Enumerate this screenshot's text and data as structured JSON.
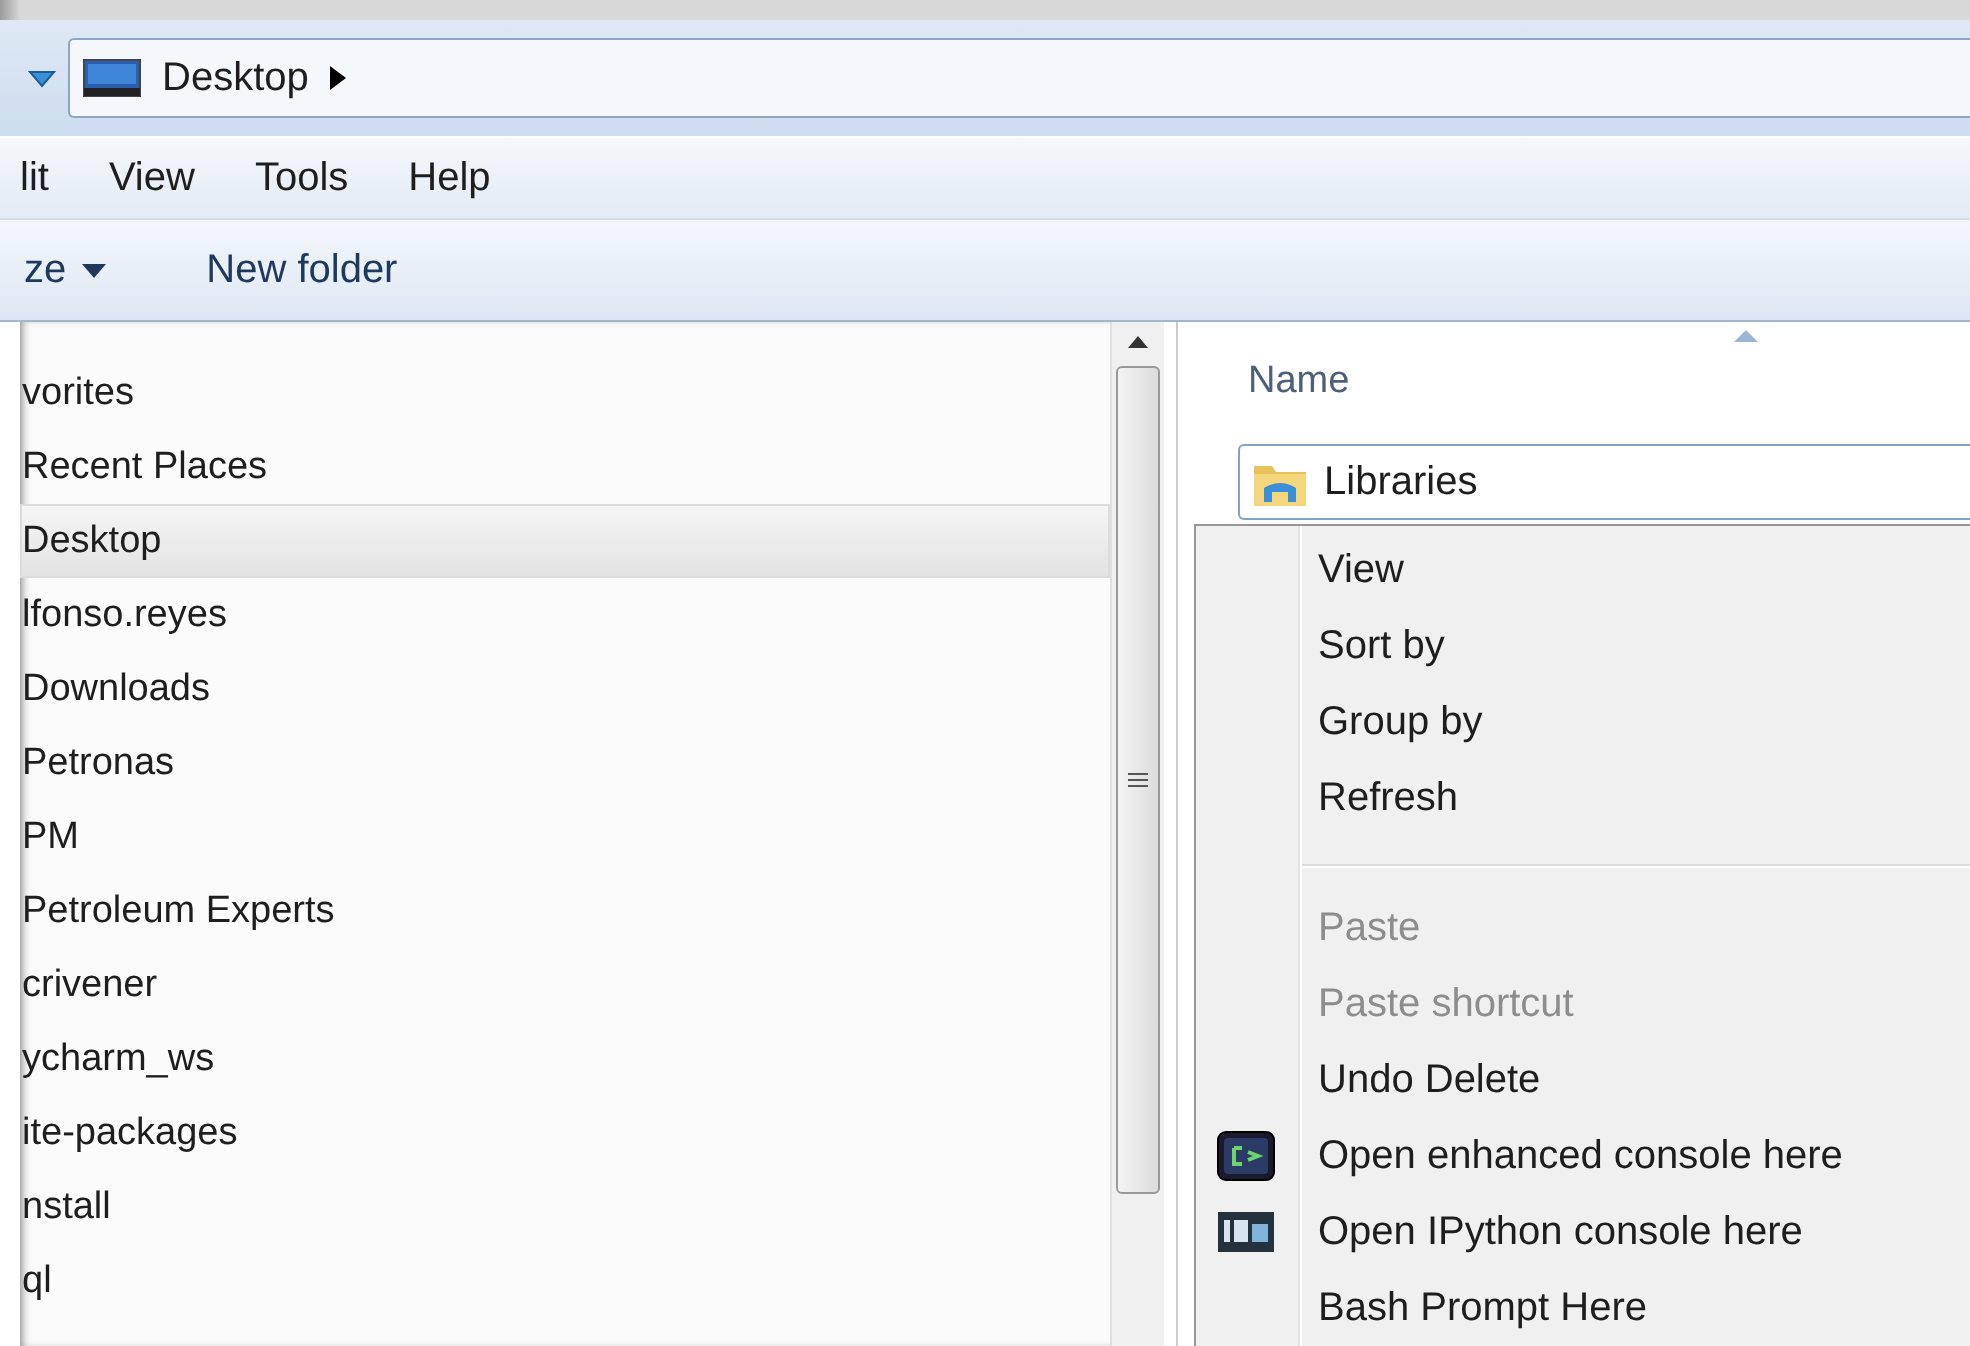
{
  "address_bar": {
    "location": "Desktop"
  },
  "menu_bar": [
    "lit",
    "View",
    "Tools",
    "Help"
  ],
  "toolbar": {
    "organize": "ze",
    "new_folder": "New folder"
  },
  "navigation": {
    "items": [
      {
        "label": "vorites",
        "selected": false
      },
      {
        "label": "Recent Places",
        "selected": false
      },
      {
        "label": "Desktop",
        "selected": true
      },
      {
        "label": "lfonso.reyes",
        "selected": false
      },
      {
        "label": "Downloads",
        "selected": false
      },
      {
        "label": "Petronas",
        "selected": false
      },
      {
        "label": "PM",
        "selected": false
      },
      {
        "label": "Petroleum Experts",
        "selected": false
      },
      {
        "label": "crivener",
        "selected": false
      },
      {
        "label": "ycharm_ws",
        "selected": false
      },
      {
        "label": "ite-packages",
        "selected": false
      },
      {
        "label": "nstall",
        "selected": false
      },
      {
        "label": "ql",
        "selected": false
      }
    ]
  },
  "file_list": {
    "column": "Name",
    "items": [
      {
        "name": "Libraries",
        "selected": true
      }
    ]
  },
  "context_menu": {
    "items": [
      {
        "kind": "command",
        "label": "View",
        "disabled": false
      },
      {
        "kind": "command",
        "label": "Sort by",
        "disabled": false
      },
      {
        "kind": "command",
        "label": "Group by",
        "disabled": false
      },
      {
        "kind": "command",
        "label": "Refresh",
        "disabled": false
      },
      {
        "kind": "separator"
      },
      {
        "kind": "command",
        "label": "Paste",
        "disabled": true
      },
      {
        "kind": "command",
        "label": "Paste shortcut",
        "disabled": true
      },
      {
        "kind": "command",
        "label": "Undo Delete",
        "disabled": false
      },
      {
        "kind": "console",
        "label": "Open enhanced console here",
        "disabled": false
      },
      {
        "kind": "ipython",
        "label": "Open IPython console here",
        "disabled": false
      },
      {
        "kind": "command",
        "label": "Bash Prompt Here",
        "disabled": false
      }
    ]
  }
}
